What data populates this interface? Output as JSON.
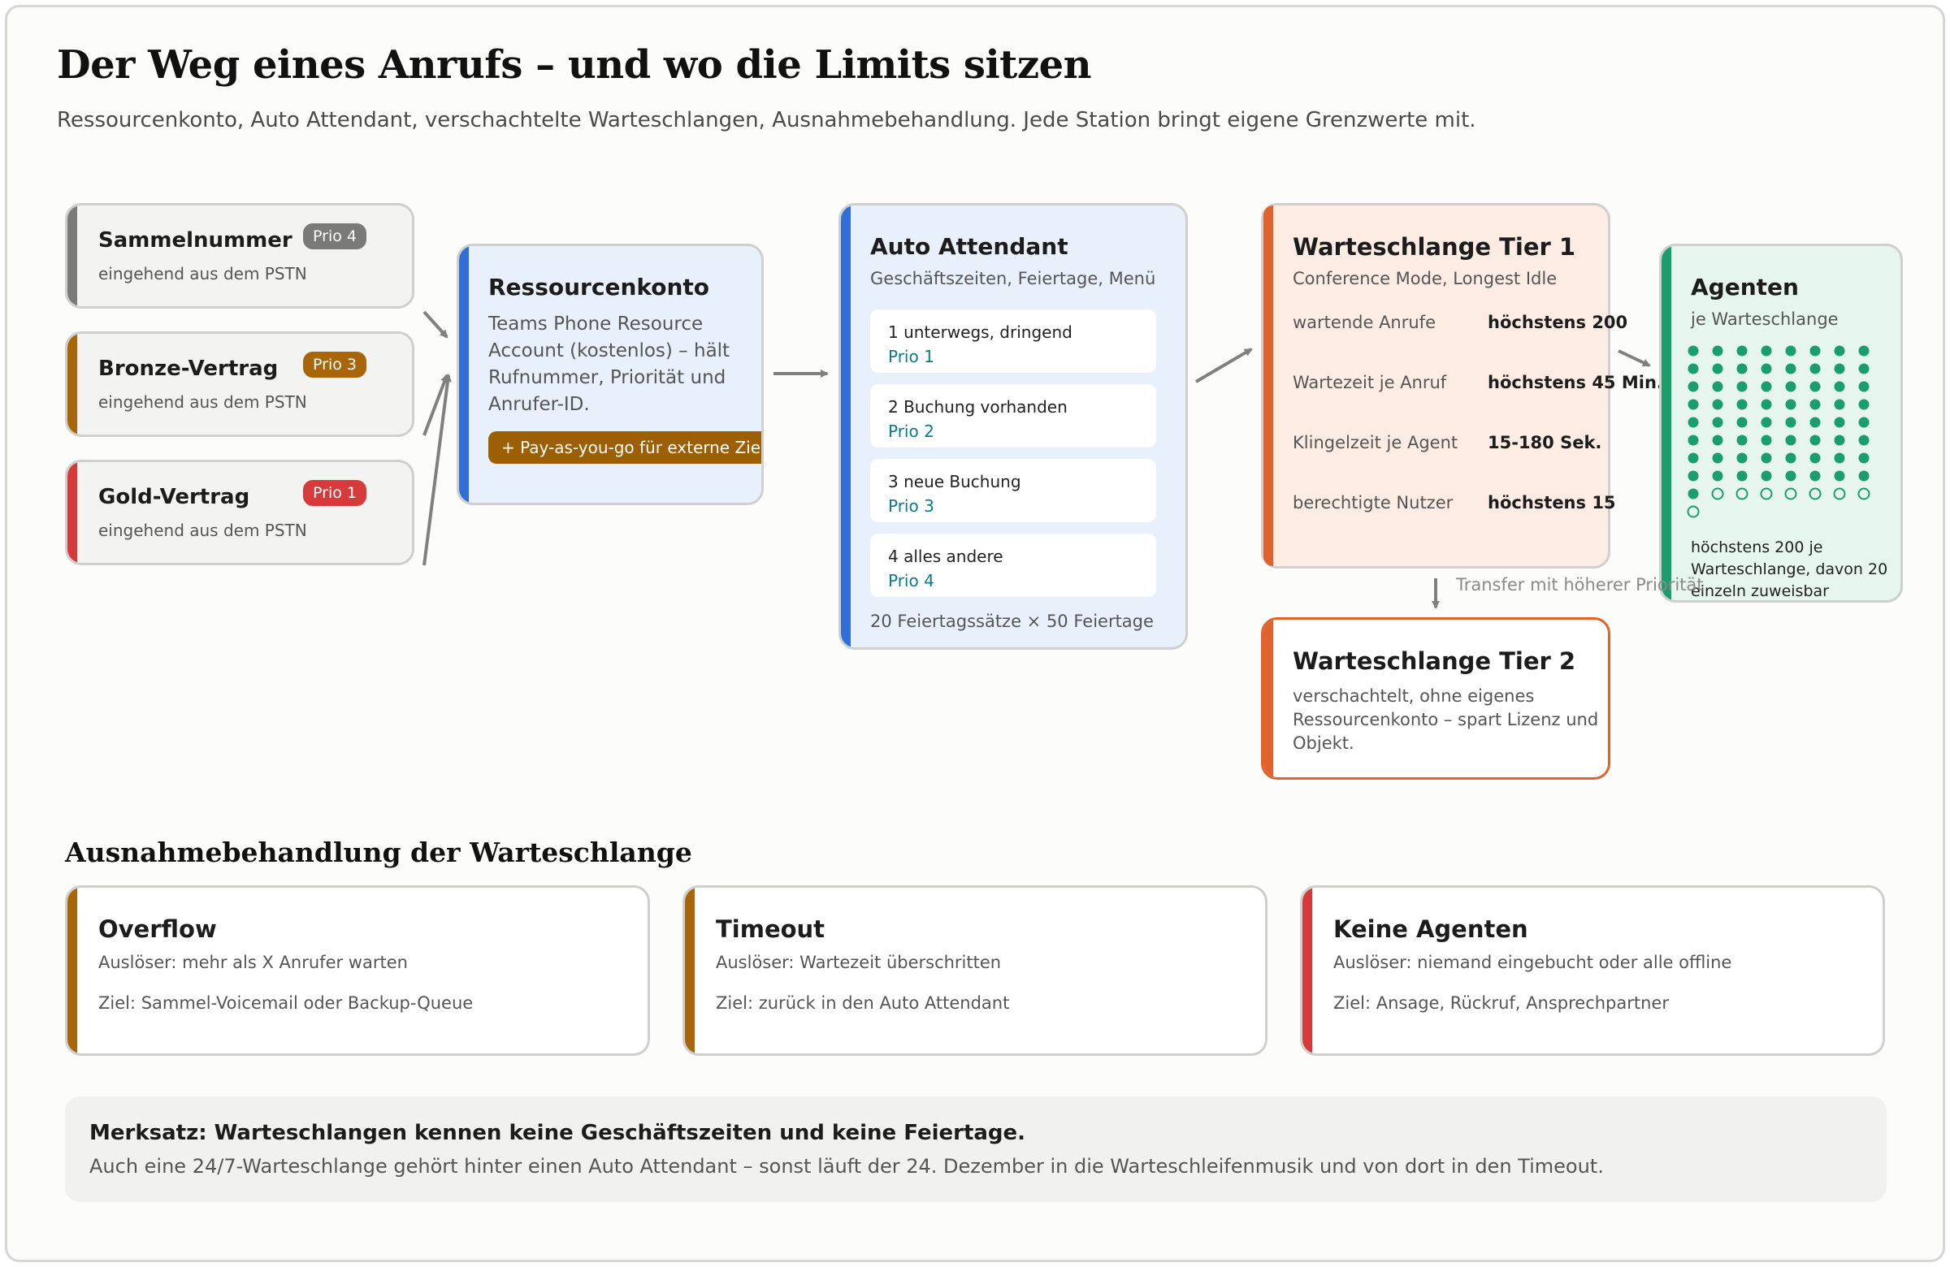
{
  "header": {
    "title": "Der Weg eines Anrufs – und wo die Limits sitzen",
    "subtitle": "Ressourcenkonto, Auto Attendant, verschachtelte Warteschlangen, Ausnahmebehandlung. Jede Station bringt eigene Grenzwerte mit."
  },
  "sources": [
    {
      "name": "Sammelnummer",
      "desc": "eingehend aus dem PSTN",
      "prio": "Prio 4",
      "color": "#7a7a78"
    },
    {
      "name": "Bronze-Vertrag",
      "desc": "eingehend aus dem PSTN",
      "prio": "Prio 3",
      "color": "#a8650a"
    },
    {
      "name": "Gold-Vertrag",
      "desc": "eingehend aus dem PSTN",
      "prio": "Prio 1",
      "color": "#d63a3a"
    }
  ],
  "resource": {
    "title": "Ressourcenkonto",
    "desc": "Teams Phone Resource Account (kostenlos) – hält Rufnummer, Priorität und Anrufer-ID.",
    "pill": "+ Pay-as-you-go für externe Ziele",
    "color": "#2f6fd6"
  },
  "auto_attendant": {
    "title": "Auto Attendant",
    "subtitle": "Geschäftszeiten, Feiertage, Menü",
    "options": [
      {
        "label": "1  unterwegs, dringend",
        "prio": "Prio 1"
      },
      {
        "label": "2  Buchung vorhanden",
        "prio": "Prio 2"
      },
      {
        "label": "3  neue Buchung",
        "prio": "Prio 3"
      },
      {
        "label": "4  alles andere",
        "prio": "Prio 4"
      }
    ],
    "footer": "20 Feiertagssätze × 50 Feiertage",
    "color": "#2f6fd6"
  },
  "queue_tier1": {
    "title": "Warteschlange Tier 1",
    "subtitle": "Conference Mode, Longest Idle",
    "rows": [
      {
        "key": "wartende Anrufe",
        "value": "höchstens 200"
      },
      {
        "key": "Wartezeit je Anruf",
        "value": "höchstens 45 Min."
      },
      {
        "key": "Klingelzeit je Agent",
        "value": "15-180 Sek."
      },
      {
        "key": "berechtigte Nutzer",
        "value": "höchstens 15"
      }
    ],
    "color": "#e0632d"
  },
  "agents": {
    "title": "Agenten",
    "subtitle": "je Warteschlange",
    "footer": "höchstens 200 je Warteschlange, davon 20 einzeln zuweisbar",
    "filled": 65,
    "total": 73,
    "color": "#1a9e6e"
  },
  "transfer_label": "Transfer mit höherer Priorität",
  "queue_tier2": {
    "title": "Warteschlange Tier 2",
    "desc": "verschachtelt, ohne eigenes Ressourcenkonto – spart Lizenz und Objekt.",
    "color": "#e0632d"
  },
  "exceptions": {
    "title": "Ausnahmebehandlung der Warteschlange",
    "items": [
      {
        "title": "Overflow",
        "trigger": "Auslöser: mehr als X Anrufer warten",
        "target": "Ziel: Sammel-Voicemail oder Backup-Queue",
        "color": "#a8650a"
      },
      {
        "title": "Timeout",
        "trigger": "Auslöser: Wartezeit überschritten",
        "target": "Ziel: zurück in den Auto Attendant",
        "color": "#a8650a"
      },
      {
        "title": "Keine Agenten",
        "trigger": "Auslöser: niemand eingebucht oder alle offline",
        "target": "Ziel: Ansage, Rückruf, Ansprechpartner",
        "color": "#d63a3a"
      }
    ]
  },
  "note": {
    "heading": "Merksatz: Warteschlangen kennen keine Geschäftszeiten und keine Feiertage.",
    "text": "Auch eine 24/7-Warteschlange gehört hinter einen Auto Attendant – sonst läuft der 24. Dezember in die Warteschleifenmusik und von dort in den Timeout."
  }
}
